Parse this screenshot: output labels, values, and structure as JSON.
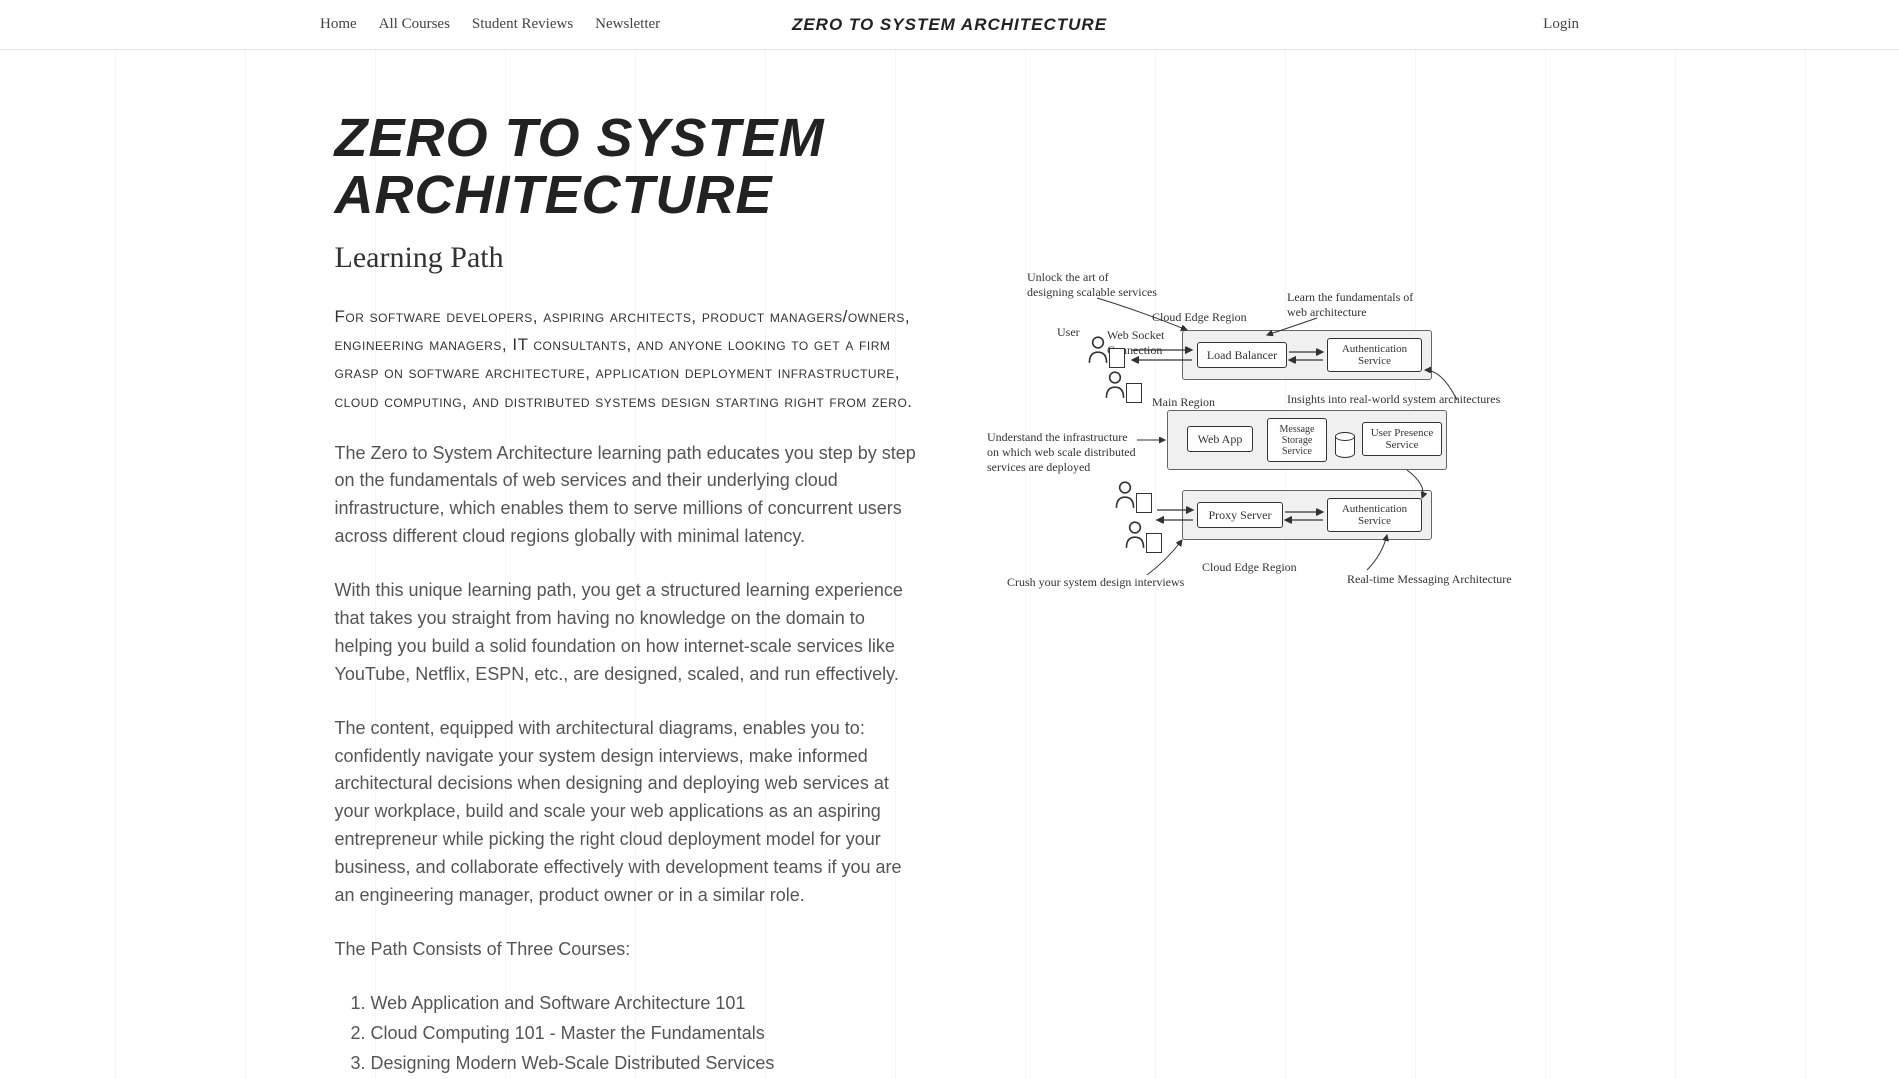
{
  "nav": {
    "items": [
      "Home",
      "All Courses",
      "Student Reviews",
      "Newsletter"
    ],
    "brand": "ZERO TO SYSTEM ARCHITECTURE",
    "login": "Login"
  },
  "hero": {
    "title": "ZERO TO SYSTEM ARCHITECTURE",
    "subtitle": "Learning Path",
    "intro": "For software developers, aspiring architects, product managers/owners, engineering managers, IT consultants, and anyone looking to get a firm grasp on software architecture, application deployment infrastructure, cloud computing, and distributed systems design starting right from zero.",
    "p1": "The Zero to System Architecture learning path educates you step by step on the fundamentals of web services and their underlying cloud infrastructure, which enables them to serve millions of concurrent users across different cloud regions globally with minimal latency.",
    "p2": "With this unique learning path, you get a structured learning experience that takes you straight from having no knowledge on the domain to helping you build a solid foundation on how internet-scale services like YouTube, Netflix, ESPN, etc., are designed, scaled, and run effectively.",
    "p3": "The content, equipped with architectural diagrams, enables you to: confidently navigate your system design interviews, make informed architectural decisions when designing and deploying web services at your workplace, build and scale your web applications as an aspiring entrepreneur while picking the right cloud deployment model for your business, and collaborate effectively with development teams if you are an engineering manager, product owner or in a similar role.",
    "p4": "The Path Consists of Three Courses:",
    "courses": [
      "Web Application and Software Architecture 101",
      "Cloud Computing 101 - Master the Fundamentals",
      "Designing Modern Web-Scale Distributed Services"
    ]
  },
  "diagram": {
    "notes": {
      "unlock": "Unlock the art of\ndesigning scalable services",
      "learn": "Learn the fundamentals of\nweb architecture",
      "cloud_edge_top": "Cloud Edge Region",
      "user": "User",
      "websocket": "Web Socket\nConnection",
      "main_region": "Main Region",
      "insights": "Insights into real-world system architectures",
      "understand": "Understand the infrastructure\non which web scale distributed\nservices are deployed",
      "cloud_edge_bottom": "Cloud Edge Region",
      "crush": "Crush your system design interviews",
      "realtime": "Real-time Messaging Architecture"
    },
    "boxes": {
      "load_balancer": "Load Balancer",
      "auth_top": "Authentication\nService",
      "web_app": "Web App",
      "msg_storage": "Message\nStorage\nService",
      "user_presence": "User Presence\nService",
      "proxy": "Proxy Server",
      "auth_bottom": "Authentication\nService"
    }
  }
}
